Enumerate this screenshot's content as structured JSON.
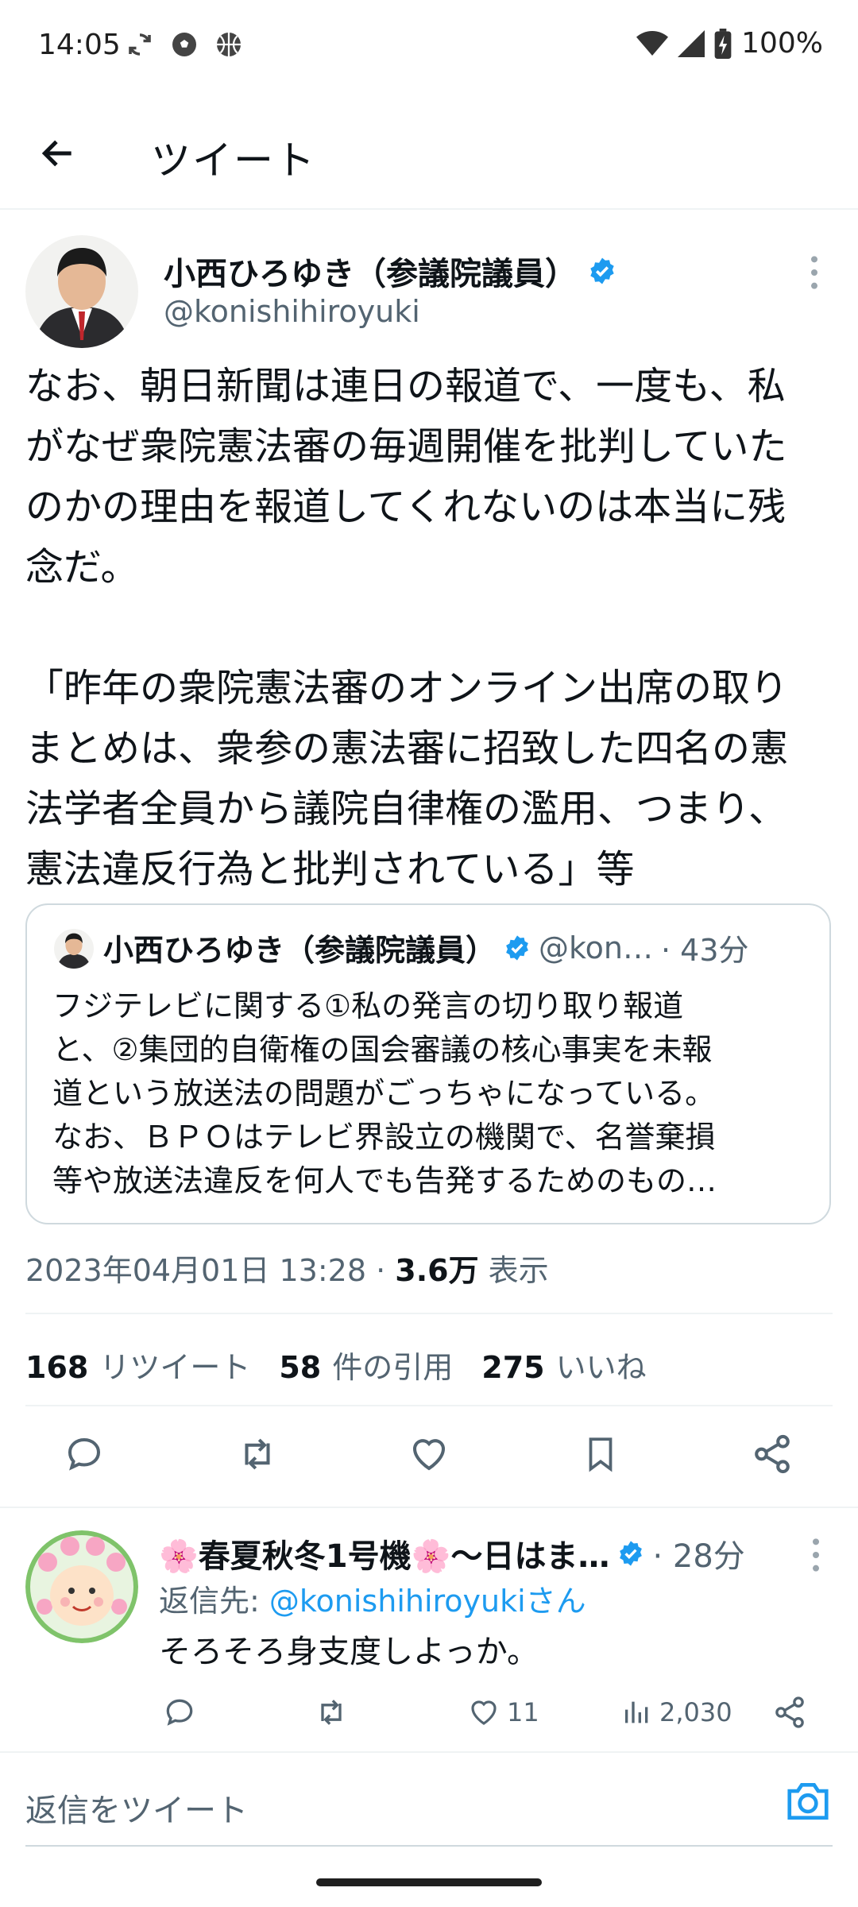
{
  "status_bar": {
    "time": "14:05",
    "battery": "100%",
    "icons": [
      "sync-icon",
      "soccer-ball-icon",
      "basketball-icon",
      "wifi-icon",
      "signal-icon",
      "battery-icon"
    ]
  },
  "header": {
    "title": "ツイート"
  },
  "tweet": {
    "author_name": "小西ひろゆき（参議院議員）",
    "handle": "@konishihiroyuki",
    "text": "なお、朝日新聞は連日の報道で、一度も、私\nがなぜ衆院憲法審の毎週開催を批判していた\nのかの理由を報道してくれないのは本当に残\n念だ。\n\n「昨年の衆院憲法審のオンライン出席の取り\nまとめは、衆参の憲法審に招致した四名の憲\n法学者全員から議院自律権の濫用、つまり、\n憲法違反行為と批判されている」等",
    "quote": {
      "author_name": "小西ひろゆき（参議院議員）",
      "handle": "@kon…",
      "time": "· 43分",
      "text": "フジテレビに関する①私の発言の切り取り報道\nと、②集団的自衛権の国会審議の核心事実を未報\n道という放送法の問題がごっちゃになっている。\nなお、ＢＰＯはテレビ界設立の機関で、名誉棄損\n等や放送法違反を何人でも告発するためのもの…"
    },
    "timestamp": "2023年04月01日 13:28 · ",
    "views_count": "3.6万",
    "views_label": " 表示",
    "stats": {
      "retweets_count": "168",
      "retweets_label": "リツイート",
      "quotes_count": "58",
      "quotes_label": "件の引用",
      "likes_count": "275",
      "likes_label": "いいね"
    }
  },
  "reply": {
    "author_name": "🌸春夏秋冬1号機🌸～日はま…",
    "time": "· 28分",
    "reply_to_prefix": "返信先: ",
    "reply_to_handle": "@konishihiroyukiさん",
    "text": "そろそろ身支度しよっか。",
    "likes": "11",
    "views": "2,030"
  },
  "compose": {
    "placeholder": "返信をツイート"
  },
  "colors": {
    "accent": "#1d9bf0",
    "text": "#0f1419",
    "secondary": "#536471",
    "border": "#eff3f4"
  }
}
